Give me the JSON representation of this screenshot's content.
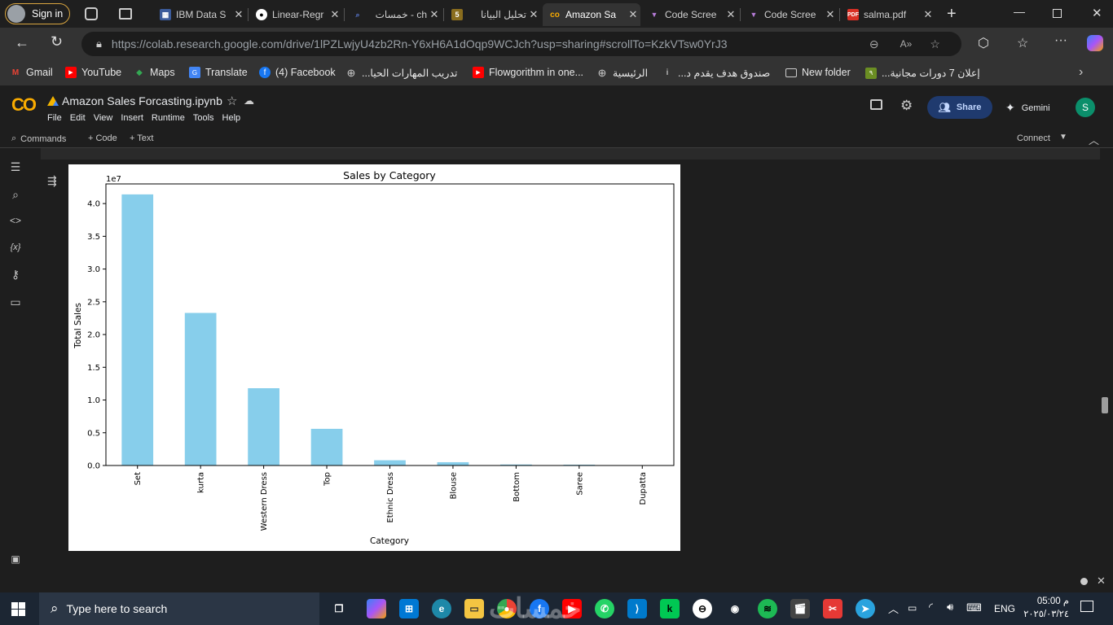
{
  "browser": {
    "signin_label": "Sign in",
    "tabs": [
      {
        "title": "IBM Data S",
        "icon": "ibm-icon"
      },
      {
        "title": "Linear-Regr",
        "icon": "github-icon"
      },
      {
        "title": "ch - خمسات",
        "icon": "search-icon"
      },
      {
        "title": "تحليل البيانا",
        "icon": "page-icon"
      },
      {
        "title": "Amazon Sa",
        "icon": "colab-icon",
        "active": true
      },
      {
        "title": "Code Scree",
        "icon": "v0-icon"
      },
      {
        "title": "Code Scree",
        "icon": "v0-icon"
      },
      {
        "title": "salma.pdf",
        "icon": "pdf-icon"
      }
    ],
    "url": "https://colab.research.google.com/drive/1lPZLwjyU4zb2Rn-Y6xH6A1dOqp9WCJch?usp=sharing#scrollTo=KzkVTsw0YrJ3",
    "bookmarks": [
      {
        "label": "Gmail",
        "icon": "gmail-icon"
      },
      {
        "label": "YouTube",
        "icon": "youtube-icon"
      },
      {
        "label": "Maps",
        "icon": "maps-icon"
      },
      {
        "label": "Translate",
        "icon": "translate-icon"
      },
      {
        "label": "(4) Facebook",
        "icon": "facebook-icon"
      },
      {
        "label": "تدريب المهارات الحيا...",
        "icon": "globe-icon"
      },
      {
        "label": "Flowgorithm in one...",
        "icon": "youtube-icon"
      },
      {
        "label": "الرئيسية",
        "icon": "globe-icon"
      },
      {
        "label": "صندوق هدف يقدم د...",
        "icon": "info-icon"
      },
      {
        "label": "New folder",
        "icon": "folder-icon"
      },
      {
        "label": "إعلان 7 دورات مجانية...",
        "icon": "page-icon"
      }
    ]
  },
  "colab": {
    "notebook_title": "Amazon Sales Forcasting.ipynb",
    "menu": [
      "File",
      "Edit",
      "View",
      "Insert",
      "Runtime",
      "Tools",
      "Help"
    ],
    "share_label": "Share",
    "gemini_label": "Gemini",
    "avatar_letter": "S",
    "commands_label": "Commands",
    "add_code_label": "+ Code",
    "add_text_label": "+ Text",
    "connect_label": "Connect"
  },
  "chart_data": {
    "type": "bar",
    "title": "Sales by Category",
    "xlabel": "Category",
    "ylabel": "Total Sales",
    "y_multiplier_label": "1e7",
    "ylim": [
      0,
      4.3
    ],
    "yticks": [
      "0.0",
      "0.5",
      "1.0",
      "1.5",
      "2.0",
      "2.5",
      "3.0",
      "3.5",
      "4.0"
    ],
    "categories": [
      "Set",
      "kurta",
      "Western Dress",
      "Top",
      "Ethnic Dress",
      "Blouse",
      "Bottom",
      "Saree",
      "Dupatta"
    ],
    "values": [
      4.14,
      2.33,
      1.18,
      0.56,
      0.08,
      0.05,
      0.015,
      0.012,
      0.001
    ],
    "bar_color": "#87CEEB"
  },
  "taskbar": {
    "search_placeholder": "Type here to search",
    "language": "ENG",
    "time": "05:00 م",
    "date": "٢٠٢٥/٠٣/٢٤",
    "watermark": "خمسات"
  }
}
